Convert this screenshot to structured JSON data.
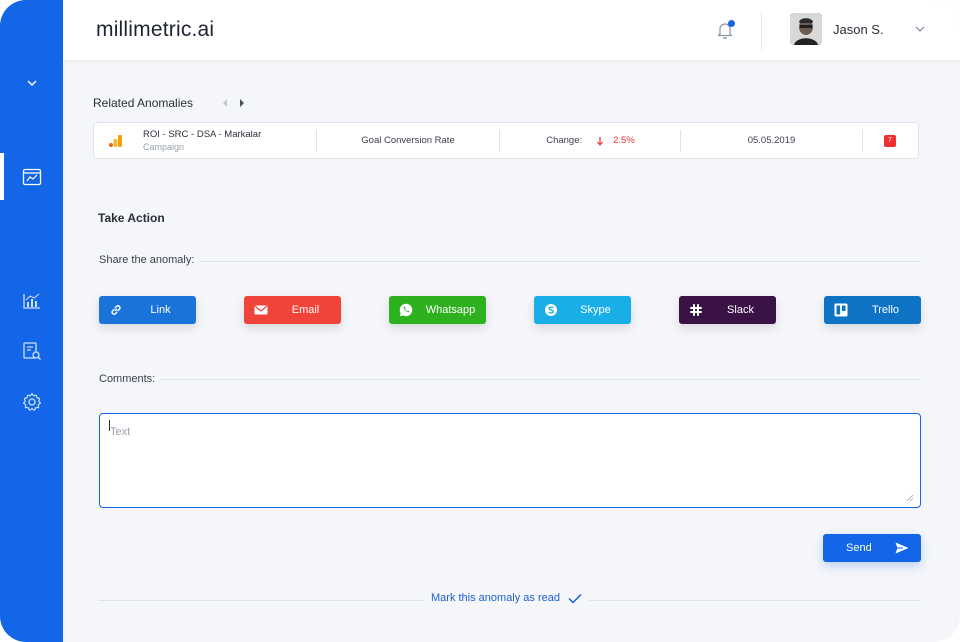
{
  "app": {
    "logo": "millimetric.ai"
  },
  "header": {
    "username": "Jason S.",
    "notification_icon": "bell-icon",
    "has_notification": true
  },
  "sidebar": {
    "items": [
      {
        "name": "collapse",
        "icon": "chevron-down-icon"
      },
      {
        "name": "anomalies",
        "icon": "browser-chart-icon",
        "active": true
      },
      {
        "name": "analytics",
        "icon": "bar-chart-icon"
      },
      {
        "name": "reports",
        "icon": "search-document-icon"
      },
      {
        "name": "settings",
        "icon": "gear-icon"
      }
    ]
  },
  "related": {
    "title": "Related Anomalies",
    "row": {
      "campaign": "ROI - SRC - DSA - Markalar",
      "campaign_type": "Campaign",
      "metric": "Goal Conversion Rate",
      "change_label": "Change:",
      "change_value": "2.5%",
      "change_direction": "down",
      "date": "05.05.2019",
      "badge": "7"
    }
  },
  "action": {
    "title": "Take Action",
    "share_label": "Share the anomaly:",
    "share_buttons": [
      {
        "label": "Link",
        "color": "#1a73d9",
        "icon": "link-icon"
      },
      {
        "label": "Email",
        "color": "#f0433a",
        "icon": "email-icon"
      },
      {
        "label": "Whatsapp",
        "color": "#2db11e",
        "icon": "whatsapp-icon"
      },
      {
        "label": "Skype",
        "color": "#19aee8",
        "icon": "skype-icon"
      },
      {
        "label": "Slack",
        "color": "#3b1245",
        "icon": "slack-icon"
      },
      {
        "label": "Trello",
        "color": "#0e73c4",
        "icon": "trello-icon"
      }
    ],
    "comments_label": "Comments:",
    "comment_placeholder": "Text",
    "send_label": "Send",
    "mark_read_label": "Mark this anomaly as read"
  },
  "colors": {
    "primary": "#1366e8",
    "negative": "#ee3030",
    "background": "#f4f6fa"
  }
}
